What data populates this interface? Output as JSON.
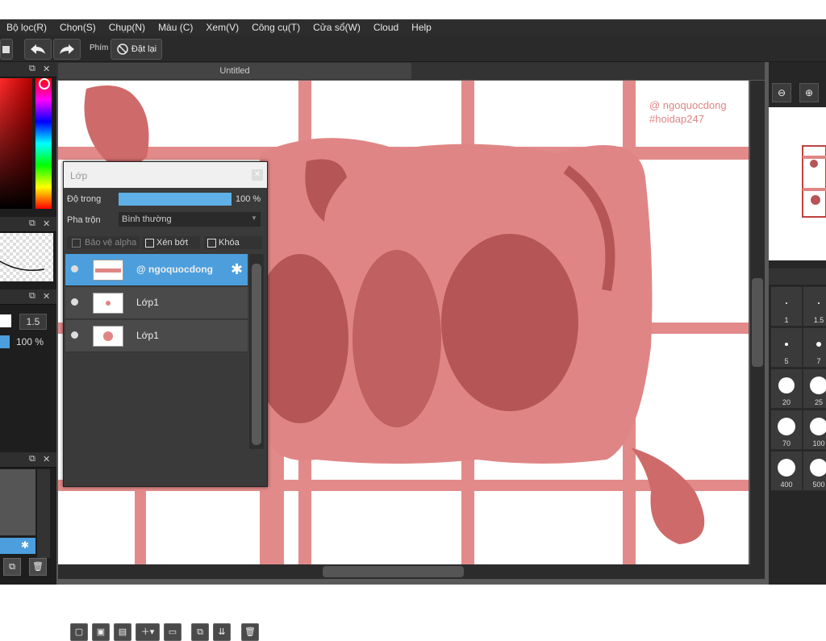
{
  "menu": [
    "Bộ lọc(R)",
    "Chọn(S)",
    "Chụp(N)",
    "Màu (C)",
    "Xem(V)",
    "Công cụ(T)",
    "Cửa sổ(W)",
    "Cloud",
    "Help"
  ],
  "toolbar": {
    "shortcut_label": "Phím",
    "reset_label": "Đặt lại"
  },
  "document": {
    "tab_title": "Untitled"
  },
  "watermark": {
    "line1": "@ ngoquocdong",
    "line2": "#hoidap247"
  },
  "left_panel": {
    "brush_size_value": "1.5",
    "opacity_value": "100 %"
  },
  "layers": {
    "title": "Lớp",
    "opacity_label": "Độ trong",
    "opacity_value": "100 %",
    "opacity_fraction": 1.0,
    "blend_label": "Pha trộn",
    "blend_value": "Bình thường",
    "protect_alpha_label": "Bảo vệ alpha",
    "clip_label": "Xén bớt",
    "lock_label": "Khóa",
    "items": [
      {
        "name": "@ ngoquocdong",
        "selected": true
      },
      {
        "name": "Lớp1",
        "selected": false
      },
      {
        "name": "Lớp1",
        "selected": false
      }
    ]
  },
  "brush_sizes": [
    "1",
    "1.5",
    "5",
    "7",
    "20",
    "25",
    "70",
    "100",
    "400",
    "500"
  ],
  "colors": {
    "accent": "#4c9fdc",
    "drawing_pink": "#e08585",
    "drawing_dark": "#b55555"
  }
}
